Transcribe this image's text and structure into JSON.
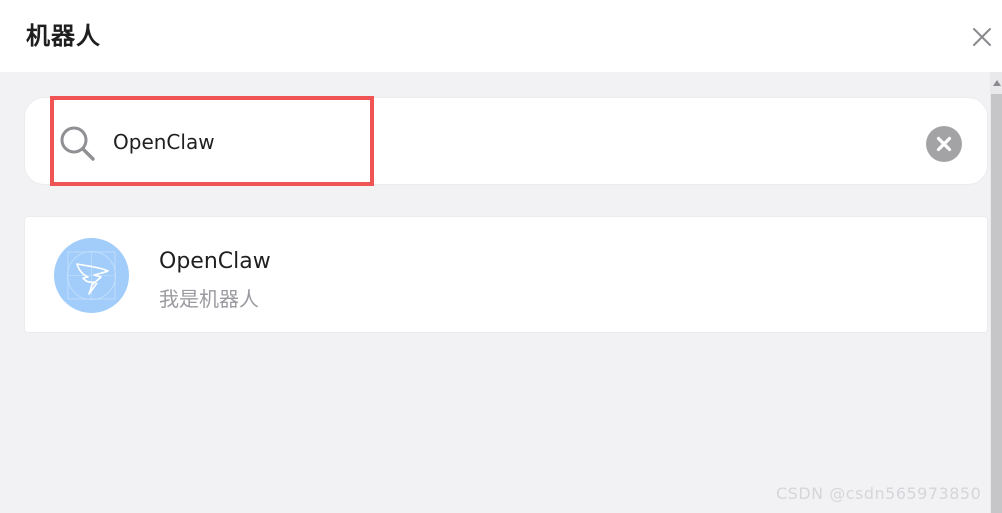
{
  "dialog": {
    "title": "机器人"
  },
  "search": {
    "value": "OpenClaw",
    "placeholder": ""
  },
  "results": [
    {
      "name": "OpenClaw",
      "description": "我是机器人"
    }
  ],
  "watermark": "CSDN @csdn565973850",
  "colors": {
    "highlight_border": "#f05454",
    "avatar_bg": "#a2cdfa",
    "page_bg": "#f2f2f4",
    "clear_button": "#a3a3a6"
  },
  "icons": {
    "close": "close-icon",
    "search": "search-icon",
    "clear": "clear-circle-icon",
    "avatar": "dingtalk-wing-logo"
  }
}
